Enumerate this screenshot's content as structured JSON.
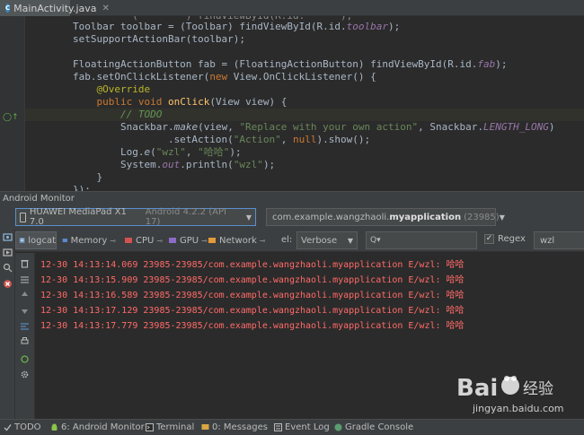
{
  "editor": {
    "tab_title": "MainActivity.java",
    "code_lines": [
      {
        "t": "                      Toolbar toolbar = (Toolbar) findViewById(R.id.toolbar);"
      },
      {
        "t": "        Toolbar toolbar = (Toolbar) findViewById(R.id.toolbar);"
      },
      {
        "t": "        setSupportActionBar(toolbar);"
      },
      {
        "t": ""
      },
      {
        "t": "        FloatingActionButton fab = (FloatingActionButton) findViewById(R.id.fab);"
      },
      {
        "t": "        fab.setOnClickListener(new View.OnClickListener() {"
      },
      {
        "t": "            @Override"
      },
      {
        "t": "            public void onClick(View view) {"
      },
      {
        "t": "                // TODO"
      },
      {
        "t": "                Snackbar.make(view, \"Replace with your own action\", Snackbar.LENGTH_LONG)"
      },
      {
        "t": "                        .setAction(\"Action\", null).show();"
      },
      {
        "t": "                Log.e(\"wzl\", \"哈哈\");"
      },
      {
        "t": "                System.out.println(\"wzl\");"
      },
      {
        "t": "            }"
      },
      {
        "t": "        });"
      }
    ]
  },
  "monitor": {
    "title": "Android Monitor",
    "device": {
      "name": "HUAWEI MediaPad X1 7.0",
      "detail": "Android 4.2.2 (API 17)"
    },
    "process": {
      "prefix": "com.example.wangzhaoli.",
      "bold": "myapplication",
      "pid": "(23985)"
    },
    "tabs": [
      {
        "label": "logcat",
        "active": true
      },
      {
        "label": "Memory"
      },
      {
        "label": "CPU"
      },
      {
        "label": "GPU"
      },
      {
        "label": "Network"
      }
    ],
    "level_label": "el:",
    "level_value": "Verbose",
    "search_placeholder": "Q▾",
    "regex_label": "Regex",
    "regex_checked": "✓",
    "filter_value": "wzl",
    "log_lines": [
      "12-30 14:13:14.069 23985-23985/com.example.wangzhaoli.myapplication E/wzl: 哈哈",
      "12-30 14:13:15.909 23985-23985/com.example.wangzhaoli.myapplication E/wzl: 哈哈",
      "12-30 14:13:16.589 23985-23985/com.example.wangzhaoli.myapplication E/wzl: 哈哈",
      "12-30 14:13:17.129 23985-23985/com.example.wangzhaoli.myapplication E/wzl: 哈哈",
      "12-30 14:13:17.779 23985-23985/com.example.wangzhaoli.myapplication E/wzl: 哈哈"
    ]
  },
  "statusbar": {
    "items": [
      {
        "label": "TODO"
      },
      {
        "label": "6: Android Monitor"
      },
      {
        "label": "Terminal"
      },
      {
        "label": "0: Messages"
      },
      {
        "label": "Event Log"
      },
      {
        "label": "Gradle Console"
      }
    ]
  },
  "watermark": {
    "brand": "Bai 经验",
    "url": "jingyan.baidu.com"
  },
  "colors": {
    "log_error": "#ff6b68",
    "keyword": "#cc7832",
    "string": "#6a8759",
    "field": "#9876aa",
    "background": "#2b2b2b",
    "panel": "#3c3f41"
  }
}
